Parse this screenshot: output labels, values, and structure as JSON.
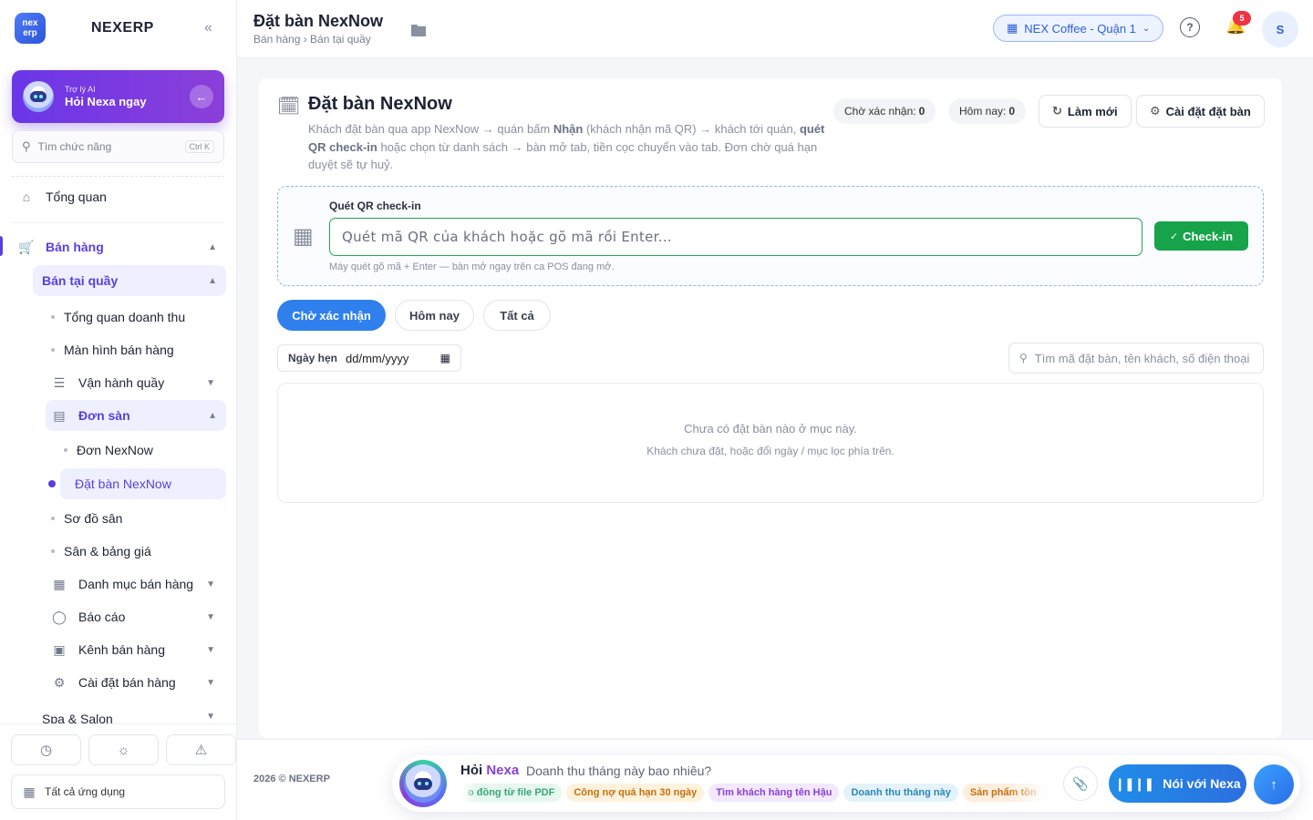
{
  "brand": {
    "logo_text": "nex erp",
    "name": "NEXERP",
    "collapse_icon": "«"
  },
  "ai_card": {
    "small": "Trợ lý AI",
    "big": "Hỏi Nexa ngay"
  },
  "search_fn": {
    "placeholder": "Tìm chức năng",
    "shortcut": "Ctrl K"
  },
  "nav": {
    "overview": "Tổng quan",
    "sales": "Bán hàng",
    "counter_sales": "Bán tại quầy",
    "revenue_overview": "Tổng quan doanh thu",
    "sales_screen": "Màn hình bán hàng",
    "counter_ops": "Vận hành quầy",
    "platform_orders": "Đơn sàn",
    "nexnow_orders": "Đơn NexNow",
    "nexnow_booking": "Đặt bàn NexNow",
    "floor_map": "Sơ đồ sân",
    "courts_pricing": "Sân & bảng giá",
    "sales_catalog": "Danh mục bán hàng",
    "reports": "Báo cáo",
    "sales_channels": "Kênh bán hàng",
    "sales_settings": "Cài đặt bán hàng",
    "spa_salon": "Spa & Salon"
  },
  "sidebar_footer": {
    "all_apps": "Tất cả ứng dụng"
  },
  "header": {
    "title": "Đặt bàn NexNow",
    "breadcrumb": "Bán hàng › Bán tại quầy",
    "store": "NEX Coffee - Quận 1",
    "notifications": "5",
    "avatar": "S"
  },
  "main": {
    "title": "Đặt bàn NexNow",
    "desc_1": "Khách đặt bàn qua app NexNow → quán bấm ",
    "desc_b1": "Nhận",
    "desc_2": " (khách nhận mã QR) → khách tới quán, ",
    "desc_b2": "quét QR check-in",
    "desc_3": " hoặc chọn từ danh sách → bàn mở tab, tiền cọc chuyển vào tab. Đơn chờ quá hạn duyệt sẽ tự huỷ.",
    "stat_pending_label": "Chờ xác nhận:",
    "stat_pending_value": "0",
    "stat_today_label": "Hôm nay:",
    "stat_today_value": "0",
    "refresh": "Làm mới",
    "settings": "Cài đặt đặt bàn"
  },
  "qr": {
    "label": "Quét QR check-in",
    "placeholder": "Quét mã QR của khách hoặc gõ mã rồi Enter...",
    "button": "Check-in",
    "hint": "Máy quét gõ mã + Enter — bàn mở ngay trên ca POS đang mở."
  },
  "tabs": [
    {
      "label": "Chờ xác nhận",
      "active": true
    },
    {
      "label": "Hôm nay",
      "active": false
    },
    {
      "label": "Tất cả",
      "active": false
    }
  ],
  "filter": {
    "date_label": "Ngày hẹn",
    "date_value": "dd/mm/yyyy",
    "search_placeholder": "Tìm mã đặt bàn, tên khách, số điện thoại"
  },
  "empty": {
    "line1": "Chưa có đặt bàn nào ở mục này.",
    "line2": "Khách chưa đặt, hoặc đổi ngày / mục lọc phía trên."
  },
  "footer": {
    "copyright": "2026 © NEXERP"
  },
  "ask": {
    "label_prefix": "Hỏi",
    "label_name": "Nexa",
    "question": "Doanh thu tháng này bao nhiêu?",
    "chips": [
      {
        "text": "o đồng từ file PDF",
        "bg": "#e6f7ef",
        "color": "#3aa676"
      },
      {
        "text": "Công nợ quá hạn 30 ngày",
        "bg": "#fff2dc",
        "color": "#c2700f"
      },
      {
        "text": "Tìm khách hàng tên Hậu",
        "bg": "#f2e9ff",
        "color": "#8a3fd6"
      },
      {
        "text": "Doanh thu tháng này",
        "bg": "#e4f3fb",
        "color": "#2b86b8"
      },
      {
        "text": "Sản phẩm tồn",
        "bg": "#fdeede",
        "color": "#c2700f"
      }
    ],
    "talk": "Nói với Nexa"
  }
}
